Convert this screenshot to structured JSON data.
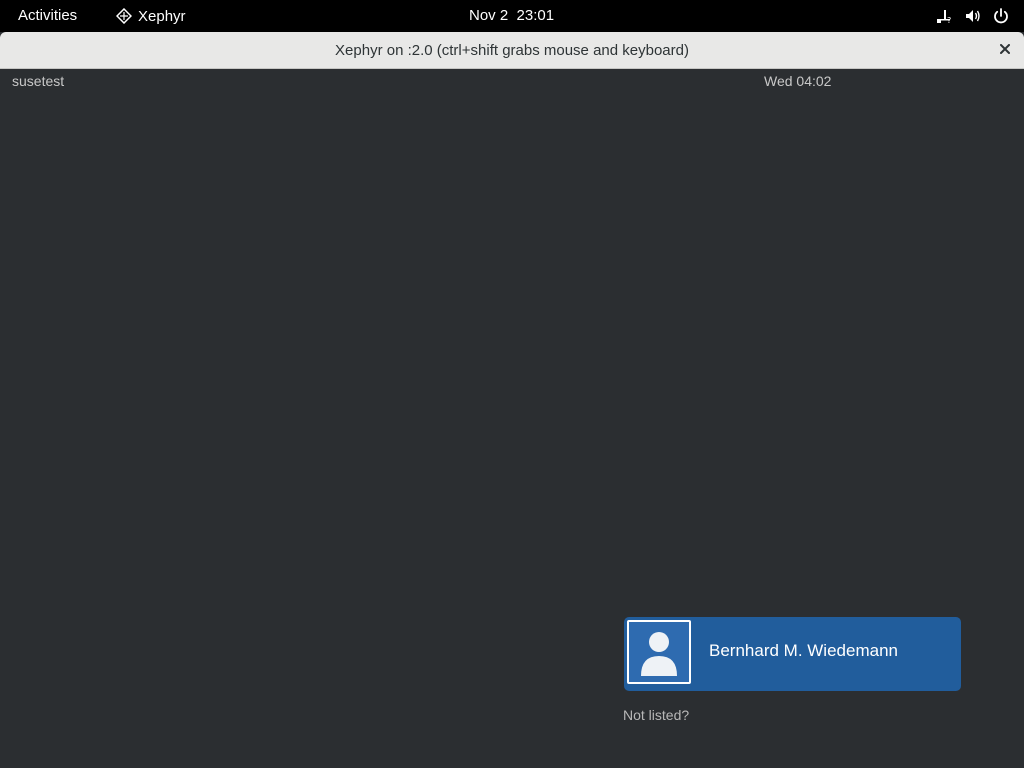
{
  "topbar": {
    "activities_label": "Activities",
    "app_name": "Xephyr",
    "clock": "Nov 2  23:01",
    "tray_icons": [
      "network-unknown-icon",
      "volume-icon",
      "power-icon"
    ]
  },
  "window": {
    "title": "Xephyr on :2.0 (ctrl+shift grabs mouse and keyboard)",
    "close_glyph": "×"
  },
  "greeter": {
    "hostname": "susetest",
    "clock": "Wed 04:02",
    "users": [
      {
        "name": "Bernhard M. Wiedemann",
        "avatar": "default-user-icon"
      }
    ],
    "not_listed_label": "Not listed?"
  },
  "colors": {
    "topbar_bg": "#000000",
    "desktop_bg": "#2b2e31",
    "user_item_bg": "#215d9c",
    "titlebar_bg": "#e8e8e7"
  }
}
